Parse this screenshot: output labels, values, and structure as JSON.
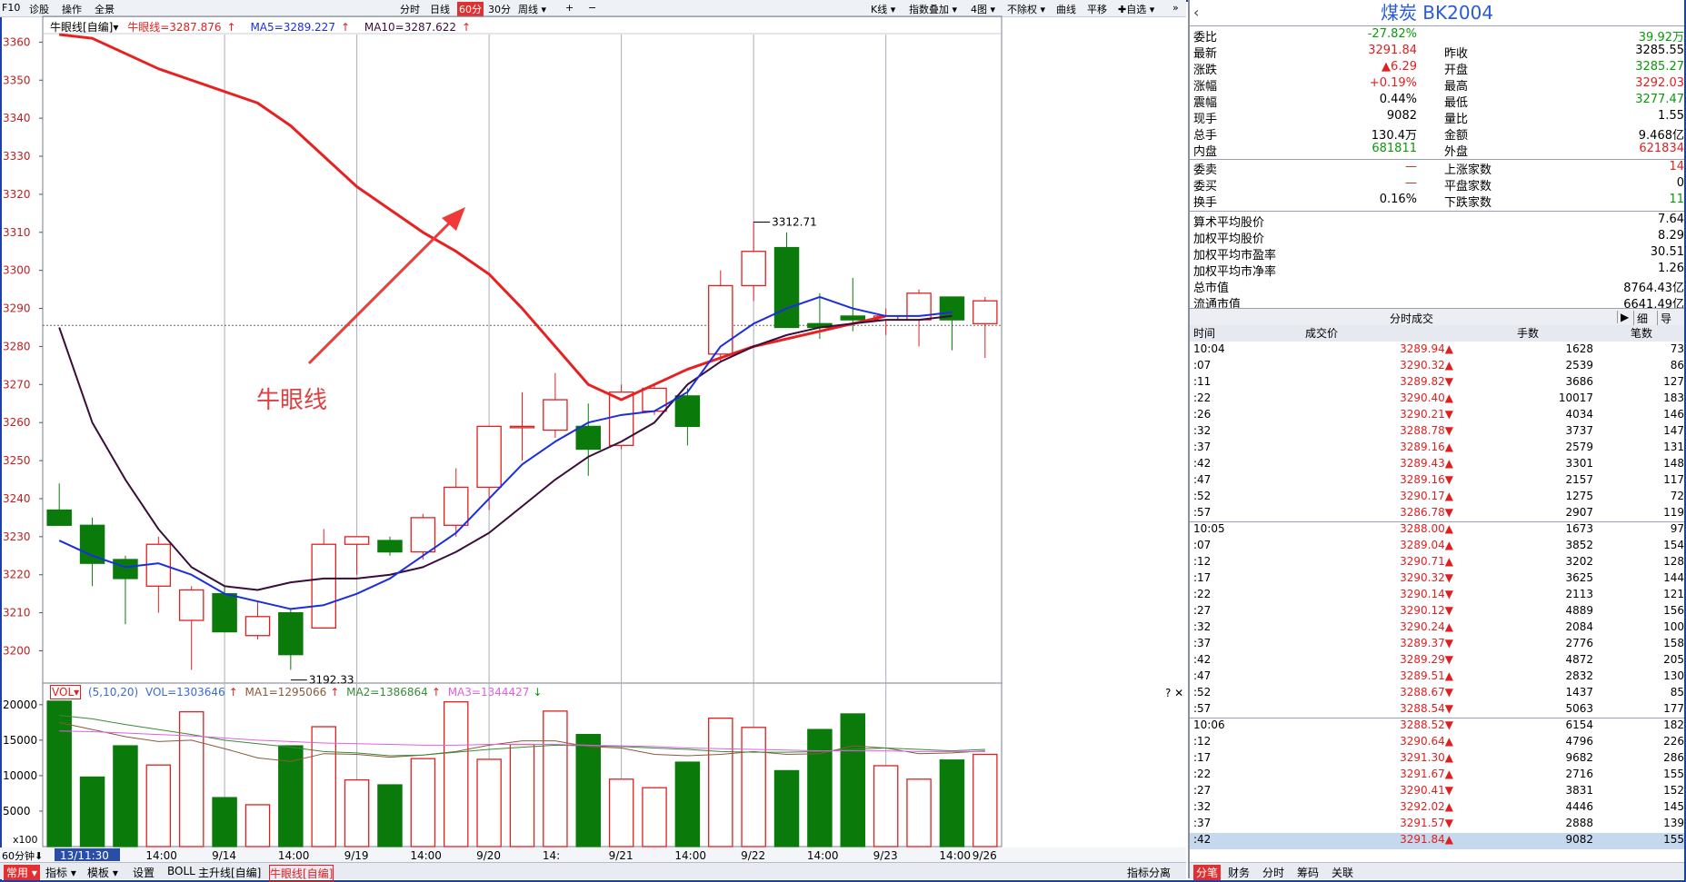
{
  "toolbar": {
    "f10": "F10",
    "diag": "诊股",
    "ops": "操作",
    "panorama": "全景",
    "fenshi": "分时",
    "daily": "日线",
    "min60": "60分",
    "min30": "30分",
    "weekly": "周线 ▾",
    "plus": "+",
    "minus": "−",
    "kline": "K线 ▾",
    "overlay": "指数叠加 ▾",
    "fourgraphs": "4图 ▾",
    "noadj": "不除权 ▾",
    "curve": "曲线",
    "pan": "平移",
    "favorite": "✚自选 ▾",
    "more": "»"
  },
  "legend": {
    "name": "牛眼线[自编]▾",
    "niu": "牛眼线=3287.876",
    "ma5": "MA5=3289.227",
    "ma10": "MA10=3287.622",
    "arrow": "↑"
  },
  "annotation": "牛眼线",
  "volume_legend": {
    "vol": "VOL▾",
    "params": "(5,10,20)",
    "vol_value": "VOL=1303646",
    "ma1": "MA1=1295066",
    "ma2": "MA2=1386864",
    "ma3": "MA3=1344427",
    "up": "↑",
    "down": "↓",
    "close_chars": "? ✕",
    "x100": "x100"
  },
  "colors": {
    "up": "#e02020",
    "down": "#0a7a0a",
    "niu_line": "#e82020",
    "ma5": "#1a2ee0",
    "ma10": "#3a0d3a",
    "vma1": "#8a5a3a",
    "vma2": "#3a8a3a",
    "vma3": "#e060e0"
  },
  "chart_data": {
    "type": "candlestick",
    "y_ticks": [
      3360,
      3350,
      3340,
      3330,
      3320,
      3310,
      3300,
      3290,
      3280,
      3270,
      3260,
      3250,
      3240,
      3230,
      3220,
      3210,
      3200
    ],
    "ylim": [
      3192,
      3362
    ],
    "x_labels": [
      "13/11:30",
      "14:00",
      "9/14",
      "14:00",
      "9/19",
      "14:00",
      "9/20",
      "14:",
      "9/21",
      "14:00",
      "9/22",
      "14:00",
      "9/23",
      "14:00",
      "9/26"
    ],
    "period_label": "60分钟",
    "candles": [
      {
        "o": 3237,
        "h": 3244,
        "l": 3234,
        "c": 3233
      },
      {
        "o": 3233,
        "h": 3235,
        "l": 3217,
        "c": 3223
      },
      {
        "o": 3224,
        "h": 3225,
        "l": 3207,
        "c": 3219
      },
      {
        "o": 3217,
        "h": 3230,
        "l": 3210,
        "c": 3228
      },
      {
        "o": 3208,
        "h": 3217,
        "l": 3195,
        "c": 3216
      },
      {
        "o": 3215,
        "h": 3217,
        "l": 3205,
        "c": 3205
      },
      {
        "o": 3204,
        "h": 3213,
        "l": 3203,
        "c": 3209
      },
      {
        "o": 3210,
        "h": 3211,
        "l": 3195,
        "c": 3199
      },
      {
        "o": 3206,
        "h": 3232,
        "l": 3206,
        "c": 3228
      },
      {
        "o": 3228,
        "h": 3230,
        "l": 3220,
        "c": 3230
      },
      {
        "o": 3229,
        "h": 3230,
        "l": 3225,
        "c": 3226
      },
      {
        "o": 3226,
        "h": 3236,
        "l": 3224,
        "c": 3235
      },
      {
        "o": 3233,
        "h": 3248,
        "l": 3230,
        "c": 3243
      },
      {
        "o": 3243,
        "h": 3259,
        "l": 3237,
        "c": 3259
      },
      {
        "o": 3259,
        "h": 3268,
        "l": 3250,
        "c": 3259
      },
      {
        "o": 3258,
        "h": 3273,
        "l": 3256,
        "c": 3266
      },
      {
        "o": 3259,
        "h": 3265,
        "l": 3246,
        "c": 3253
      },
      {
        "o": 3254,
        "h": 3270,
        "l": 3253,
        "c": 3268
      },
      {
        "o": 3263,
        "h": 3270,
        "l": 3262,
        "c": 3269
      },
      {
        "o": 3267,
        "h": 3269,
        "l": 3254,
        "c": 3259
      },
      {
        "o": 3278,
        "h": 3300,
        "l": 3276,
        "c": 3296
      },
      {
        "o": 3296,
        "h": 3312.71,
        "l": 3292,
        "c": 3305
      },
      {
        "o": 3306,
        "h": 3310,
        "l": 3285,
        "c": 3285
      },
      {
        "o": 3286,
        "h": 3294,
        "l": 3282,
        "c": 3285
      },
      {
        "o": 3288,
        "h": 3298,
        "l": 3284,
        "c": 3287
      },
      {
        "o": 3287,
        "h": 3290,
        "l": 3283,
        "c": 3288
      },
      {
        "o": 3287,
        "h": 3295,
        "l": 3280,
        "c": 3294
      },
      {
        "o": 3293,
        "h": 3292,
        "l": 3279,
        "c": 3287
      },
      {
        "o": 3286,
        "h": 3293,
        "l": 3277,
        "c": 3292
      }
    ],
    "niu_line": [
      3362,
      3361,
      3357,
      3353,
      3350,
      3347,
      3344,
      3338,
      3330,
      3322,
      3316,
      3310,
      3305,
      3299,
      3290,
      3280,
      3270,
      3266,
      3270,
      3274,
      3277,
      3280,
      3282,
      3284,
      3286,
      3288
    ],
    "ma5": [
      3229,
      3225,
      3222,
      3223,
      3220,
      3215,
      3213,
      3211,
      3212,
      3215,
      3219,
      3225,
      3231,
      3240,
      3249,
      3255,
      3260,
      3262,
      3263,
      3268,
      3280,
      3286,
      3290,
      3293,
      3290,
      3288,
      3288,
      3289
    ],
    "ma10": [
      3285,
      3260,
      3245,
      3232,
      3222,
      3217,
      3216,
      3218,
      3219,
      3219,
      3220,
      3222,
      3226,
      3231,
      3238,
      3245,
      3251,
      3255,
      3260,
      3270,
      3276,
      3280,
      3283,
      3285,
      3286,
      3287,
      3287,
      3288
    ],
    "max_label": "3312.71",
    "min_label": "3192.33",
    "volume": {
      "yticks": [
        20000,
        15000,
        10000,
        5000
      ],
      "ylim": [
        0,
        21000
      ],
      "bars": [
        20500,
        9800,
        14200,
        11500,
        19000,
        6900,
        5900,
        14200,
        16900,
        9400,
        8700,
        12400,
        20400,
        12300,
        14400,
        19100,
        15800,
        9500,
        8300,
        11900,
        18100,
        16800,
        10700,
        16500,
        18700,
        11400,
        9500,
        12200,
        13000
      ],
      "ma1": [
        17500,
        16500,
        15500,
        14800,
        15000,
        13800,
        12500,
        12000,
        13100,
        13000,
        12600,
        12900,
        13400,
        14300,
        14900,
        14900,
        14100,
        13900,
        13000,
        12800,
        13000,
        13400,
        13000,
        13100,
        14200,
        13900,
        13100,
        13200,
        13500
      ],
      "ma2": [
        18500,
        18000,
        17200,
        16500,
        15800,
        15000,
        14500,
        14000,
        13400,
        13200,
        12800,
        12900,
        13300,
        13700,
        14000,
        14300,
        14200,
        14100,
        13900,
        13700,
        13400,
        13300,
        13300,
        13400,
        13700,
        13900,
        13700,
        13500,
        13700
      ],
      "ma3": [
        16300,
        16200,
        16000,
        15800,
        15600,
        15300,
        15000,
        14800,
        14600,
        14500,
        14400,
        14300,
        14300,
        14400,
        14400,
        14400,
        14300,
        14200,
        14100,
        13900,
        13800,
        13700,
        13600,
        13500,
        13500,
        13500,
        13400,
        13400,
        13400
      ]
    }
  },
  "bottombar": {
    "common": "常用 ▾",
    "indicator": "指标 ▾",
    "template": "模板 ▾",
    "settings": "设置",
    "boll": "BOLL",
    "zsx": "主升线[自编]",
    "niu": "牛眼线[自编]",
    "indicator_tab": "指标分离"
  },
  "panel": {
    "title": "煤炭 BK2004",
    "quotes": [
      {
        "l": "委比",
        "v": "-27.82%",
        "vc": "green",
        "l2": "",
        "v2": "39.92万",
        "v2c": "green"
      },
      {
        "l": "最新",
        "v": "3291.84",
        "vc": "red",
        "l2": "昨收",
        "v2": "3285.55",
        "v2c": ""
      },
      {
        "l": "涨跌",
        "v": "▲6.29",
        "vc": "red",
        "l2": "开盘",
        "v2": "3285.27",
        "v2c": "green"
      },
      {
        "l": "涨幅",
        "v": "+0.19%",
        "vc": "red",
        "l2": "最高",
        "v2": "3292.03",
        "v2c": "red"
      },
      {
        "l": "震幅",
        "v": "0.44%",
        "vc": "",
        "l2": "最低",
        "v2": "3277.47",
        "v2c": "green"
      },
      {
        "l": "现手",
        "v": "9082",
        "vc": "",
        "l2": "量比",
        "v2": "1.55",
        "v2c": ""
      },
      {
        "l": "总手",
        "v": "130.4万",
        "vc": "",
        "l2": "金额",
        "v2": "9.468亿",
        "v2c": ""
      },
      {
        "l": "内盘",
        "v": "681811",
        "vc": "green",
        "l2": "外盘",
        "v2": "621834",
        "v2c": "red"
      }
    ],
    "quotes2": [
      {
        "l": "委卖",
        "v": "—",
        "vc": "red",
        "l2": "上涨家数",
        "v2": "14",
        "v2c": "red"
      },
      {
        "l": "委买",
        "v": "—",
        "vc": "red",
        "l2": "平盘家数",
        "v2": "0",
        "v2c": ""
      },
      {
        "l": "换手",
        "v": "0.16%",
        "vc": "",
        "l2": "下跌家数",
        "v2": "11",
        "v2c": "green"
      }
    ],
    "quotes3": [
      {
        "l": "算术平均股价",
        "v": "7.64"
      },
      {
        "l": "加权平均股价",
        "v": "8.29"
      },
      {
        "l": "加权平均市盈率",
        "v": "30.51"
      },
      {
        "l": "加权平均市净率",
        "v": "1.26"
      },
      {
        "l": "总市值",
        "v": "8764.43亿"
      },
      {
        "l": "流通市值",
        "v": "6641.49亿"
      }
    ],
    "tick_title": "分时成交",
    "tick_btns": [
      "▶",
      "细",
      "导出"
    ],
    "tick_head": [
      "时间",
      "成交价",
      "手数",
      "笔数"
    ],
    "ticks": [
      {
        "t": "10:04",
        "p": "3289.94▲",
        "d": "up",
        "v": "1628",
        "n": "73"
      },
      {
        "t": ":07",
        "p": "3290.32▲",
        "d": "up",
        "v": "2539",
        "n": "86"
      },
      {
        "t": ":11",
        "p": "3289.82▼",
        "d": "down",
        "v": "3686",
        "n": "127"
      },
      {
        "t": ":22",
        "p": "3290.40▲",
        "d": "up",
        "v": "10017",
        "n": "183"
      },
      {
        "t": ":26",
        "p": "3290.21▼",
        "d": "down",
        "v": "4034",
        "n": "146"
      },
      {
        "t": ":32",
        "p": "3288.78▼",
        "d": "down",
        "v": "3737",
        "n": "147"
      },
      {
        "t": ":37",
        "p": "3289.16▲",
        "d": "up",
        "v": "2579",
        "n": "131"
      },
      {
        "t": ":42",
        "p": "3289.43▲",
        "d": "up",
        "v": "3301",
        "n": "148"
      },
      {
        "t": ":47",
        "p": "3289.16▼",
        "d": "down",
        "v": "2157",
        "n": "117"
      },
      {
        "t": ":52",
        "p": "3290.17▲",
        "d": "up",
        "v": "1275",
        "n": "72"
      },
      {
        "t": ":57",
        "p": "3286.78▼",
        "d": "down",
        "v": "2907",
        "n": "119"
      },
      {
        "t": "10:05",
        "p": "3288.00▲",
        "d": "up",
        "v": "1673",
        "n": "97"
      },
      {
        "t": ":07",
        "p": "3289.04▲",
        "d": "up",
        "v": "3852",
        "n": "154"
      },
      {
        "t": ":12",
        "p": "3290.71▲",
        "d": "up",
        "v": "3202",
        "n": "128"
      },
      {
        "t": ":17",
        "p": "3290.32▼",
        "d": "down",
        "v": "3625",
        "n": "144"
      },
      {
        "t": ":22",
        "p": "3290.14▼",
        "d": "down",
        "v": "2113",
        "n": "121"
      },
      {
        "t": ":27",
        "p": "3290.12▼",
        "d": "down",
        "v": "4889",
        "n": "156"
      },
      {
        "t": ":32",
        "p": "3290.24▲",
        "d": "up",
        "v": "2084",
        "n": "100"
      },
      {
        "t": ":37",
        "p": "3289.37▼",
        "d": "down",
        "v": "2776",
        "n": "158"
      },
      {
        "t": ":42",
        "p": "3289.29▼",
        "d": "down",
        "v": "4872",
        "n": "205"
      },
      {
        "t": ":47",
        "p": "3289.51▲",
        "d": "up",
        "v": "2832",
        "n": "130"
      },
      {
        "t": ":52",
        "p": "3288.67▼",
        "d": "down",
        "v": "1437",
        "n": "85"
      },
      {
        "t": ":57",
        "p": "3288.54▼",
        "d": "down",
        "v": "5063",
        "n": "177"
      },
      {
        "t": "10:06",
        "p": "3288.52▼",
        "d": "down",
        "v": "6154",
        "n": "182"
      },
      {
        "t": ":12",
        "p": "3290.64▲",
        "d": "up",
        "v": "4796",
        "n": "226"
      },
      {
        "t": ":17",
        "p": "3291.30▲",
        "d": "up",
        "v": "9682",
        "n": "286"
      },
      {
        "t": ":22",
        "p": "3291.67▲",
        "d": "up",
        "v": "2716",
        "n": "155"
      },
      {
        "t": ":27",
        "p": "3290.41▼",
        "d": "down",
        "v": "3831",
        "n": "152"
      },
      {
        "t": ":32",
        "p": "3292.02▲",
        "d": "up",
        "v": "4446",
        "n": "145"
      },
      {
        "t": ":37",
        "p": "3291.57▼",
        "d": "down",
        "v": "2888",
        "n": "139"
      },
      {
        "t": ":42",
        "p": "3291.84▲",
        "d": "up",
        "v": "9082",
        "n": "155"
      }
    ],
    "bottom_tabs": [
      "分笔",
      "财务",
      "分时",
      "筹码",
      "关联"
    ]
  }
}
